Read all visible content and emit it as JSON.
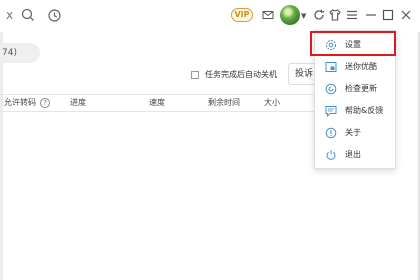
{
  "titlebar": {
    "search_clear": "x",
    "vip_label": "VIP"
  },
  "toolbar": {
    "task_count": "74)",
    "auto_shutdown": "任务完成后自动关机",
    "cast_label": "投诉"
  },
  "table": {
    "headers": [
      "允许转码",
      "进度",
      "速度",
      "剩余时间",
      "大小"
    ],
    "help_glyph": "?"
  },
  "menu": {
    "items": [
      {
        "label": "设置",
        "icon": "gear-icon"
      },
      {
        "label": "迷你优酷",
        "icon": "mini-window-icon"
      },
      {
        "label": "检查更新",
        "icon": "update-icon"
      },
      {
        "label": "帮助&反馈",
        "icon": "feedback-icon"
      },
      {
        "label": "关于",
        "icon": "info-icon"
      },
      {
        "label": "退出",
        "icon": "power-icon"
      }
    ]
  },
  "colors": {
    "highlight": "#e0191e",
    "icon_blue": "#4a90c8",
    "vip_gold": "#c8901e"
  }
}
